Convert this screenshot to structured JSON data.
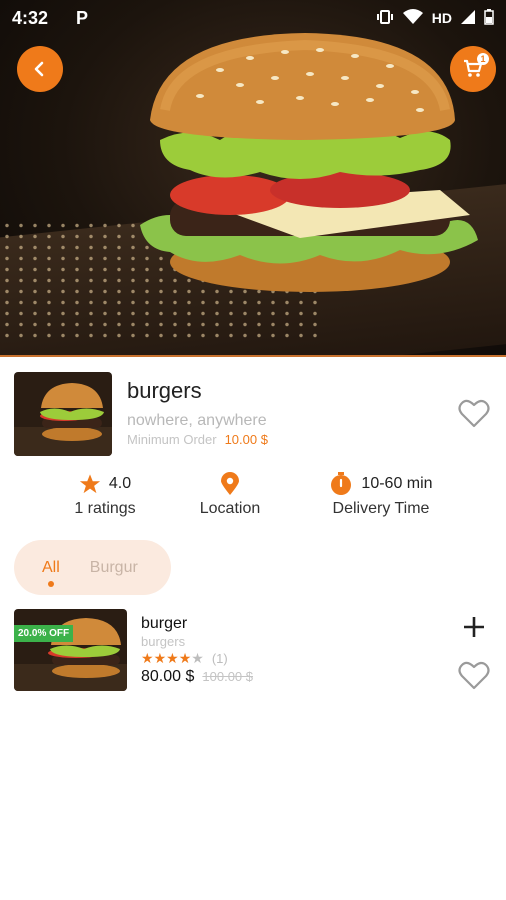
{
  "status_bar": {
    "time": "4:32",
    "p_glyph": "P",
    "network": "HD"
  },
  "cart": {
    "badge_count": "1"
  },
  "restaurant": {
    "name": "burgers",
    "address": "nowhere, anywhere",
    "min_order_label": "Minimum Order",
    "min_order_value": "10.00 $"
  },
  "info": {
    "rating": "4.0",
    "ratings_label": "1 ratings",
    "location_label": "Location",
    "delivery_time": "10-60 min",
    "delivery_label": "Delivery Time"
  },
  "tabs": [
    {
      "label": "All",
      "active": true
    },
    {
      "label": "Burgur",
      "active": false
    }
  ],
  "items": [
    {
      "name": "burger",
      "category": "burgers",
      "discount_badge": "20.0% OFF",
      "stars": 4,
      "rating_count": "(1)",
      "price": "80.00 $",
      "old_price": "100.00 $"
    }
  ],
  "colors": {
    "accent": "#ef7a1a",
    "badge_green": "#3cb24a",
    "tab_bg": "#fbeadf"
  },
  "icons": [
    "back-arrow-icon",
    "cart-icon",
    "heart-outline-icon",
    "star-icon",
    "location-pin-icon",
    "timer-icon",
    "plus-icon"
  ]
}
